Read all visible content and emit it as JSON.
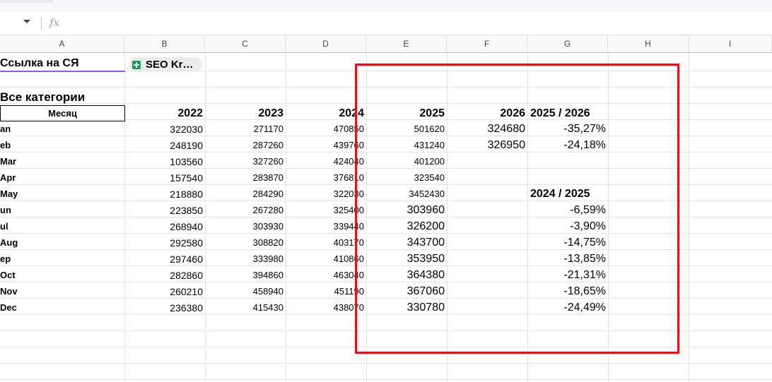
{
  "formula_bar": {
    "fx_label": "fx"
  },
  "columns": [
    "A",
    "B",
    "C",
    "D",
    "E",
    "F",
    "G",
    "H",
    "I"
  ],
  "link_label": "Ссылка на СЯ",
  "chip_label": "SEO Kr…",
  "title": "Все категории",
  "month_header": "Месяц",
  "year_headers": [
    "2022",
    "2023",
    "2024",
    "2025",
    "2026"
  ],
  "ratio_header_1": "2025 / 2026",
  "ratio_header_2": "2024 / 2025",
  "months": [
    "an",
    "eb",
    "Mar",
    "Apr",
    "May",
    "un",
    "ul",
    "Aug",
    "ep",
    "Oct",
    "Nov",
    "Dec"
  ],
  "col_2022": [
    "322030",
    "248190",
    "103560",
    "157540",
    "218880",
    "223850",
    "268940",
    "292580",
    "297460",
    "282860",
    "260210",
    "236380"
  ],
  "col_2023": [
    "271170",
    "287260",
    "327260",
    "283870",
    "284290",
    "267280",
    "303930",
    "308820",
    "333980",
    "394860",
    "458940",
    "415430"
  ],
  "col_2024": [
    "470850",
    "439760",
    "424040",
    "376810",
    "322030",
    "325400",
    "339440",
    "403170",
    "410860",
    "463040",
    "451190",
    "438070"
  ],
  "col_2025": [
    "501620",
    "431240",
    "401200",
    "323540",
    "3452430",
    "303960",
    "326200",
    "343700",
    "353950",
    "364380",
    "367060",
    "330780"
  ],
  "col_2026": [
    "324680",
    "326950"
  ],
  "ratio_2025_2026": [
    "-35,27%",
    "-24,18%"
  ],
  "ratio_2024_2025": [
    "-6,59%",
    "-3,90%",
    "-14,75%",
    "-13,85%",
    "-21,31%",
    "-18,65%",
    "-24,49%"
  ],
  "highlight_color": "#d5181f"
}
